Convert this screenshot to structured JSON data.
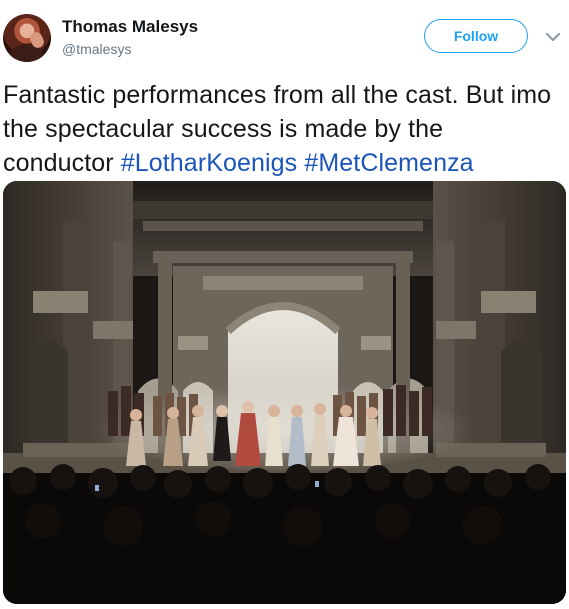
{
  "user": {
    "name": "Thomas Malesys",
    "handle": "@tmalesys",
    "avatar_icon": "profile-avatar"
  },
  "follow_button": {
    "label": "Follow",
    "color": "#1da1f2"
  },
  "menu": {
    "icon": "chevron-down-icon"
  },
  "tweet": {
    "text_before": "Fantastic performances from all the cast. But imo the spectacular success is made by the conductor ",
    "hashtags": [
      "#LotharKoenigs",
      "#MetClemenza"
    ],
    "hashtag_color": "#1b55b8"
  },
  "media": {
    "type": "photo",
    "subject": "opera-stage-curtain-call"
  }
}
